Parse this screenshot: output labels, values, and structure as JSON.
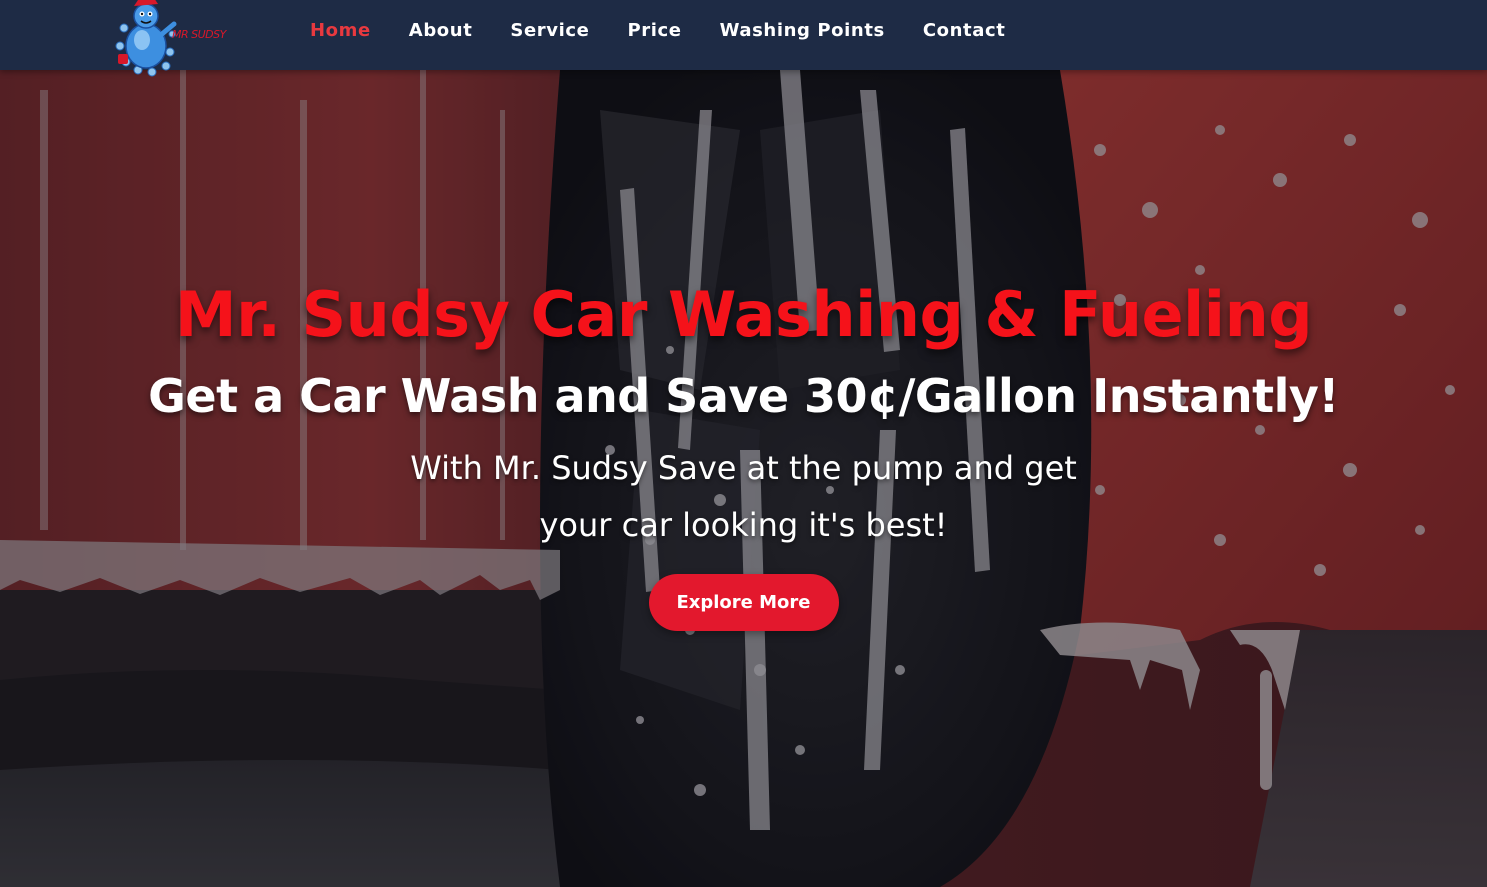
{
  "header": {
    "logo_text": "MR SUDSY",
    "nav": [
      {
        "label": "Home",
        "active": true
      },
      {
        "label": "About",
        "active": false
      },
      {
        "label": "Service",
        "active": false
      },
      {
        "label": "Price",
        "active": false
      },
      {
        "label": "Washing Points",
        "active": false
      },
      {
        "label": "Contact",
        "active": false
      }
    ]
  },
  "hero": {
    "title": "Mr. Sudsy Car Washing & Fueling",
    "subtitle": "Get a Car Wash and Save 30¢/Gallon Instantly!",
    "text": "With Mr. Sudsy Save at the pump and get your car looking it's best!",
    "button_label": "Explore More"
  },
  "colors": {
    "navbar_bg": "#1e2b45",
    "accent_red": "#e3182d",
    "title_red": "#f5121a",
    "nav_active": "#e8393f",
    "text": "#ffffff"
  },
  "icons": {
    "logo": "mr-sudsy-mascot-icon"
  }
}
